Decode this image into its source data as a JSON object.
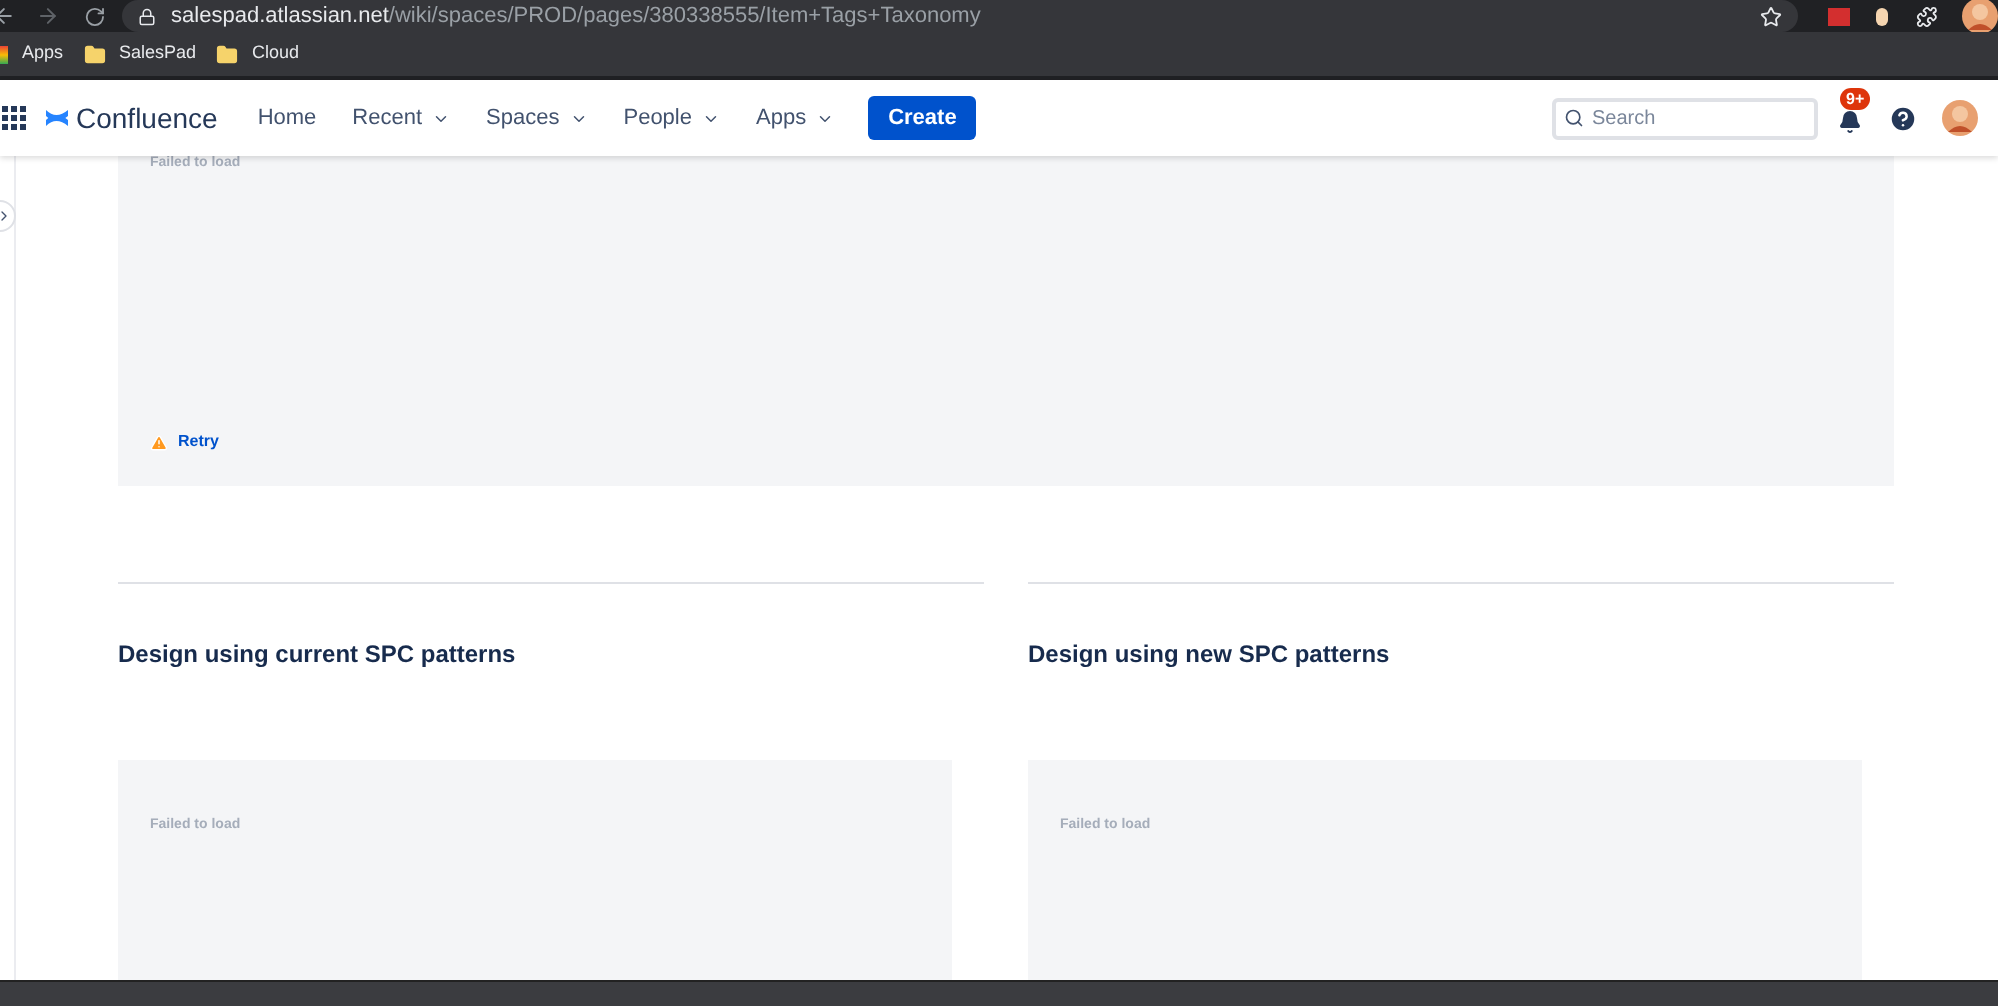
{
  "browser": {
    "url_host": "salespad.atlassian.net",
    "url_path": "/wiki/spaces/PROD/pages/380338555/Item+Tags+Taxonomy",
    "bookmarks": [
      "Apps",
      "SalesPad",
      "Cloud"
    ]
  },
  "nav": {
    "product": "Confluence",
    "items": [
      {
        "label": "Home",
        "dropdown": false
      },
      {
        "label": "Recent",
        "dropdown": true
      },
      {
        "label": "Spaces",
        "dropdown": true
      },
      {
        "label": "People",
        "dropdown": true
      },
      {
        "label": "Apps",
        "dropdown": true
      }
    ],
    "create": "Create",
    "search": {
      "placeholder": "Search"
    },
    "notification_badge": "9+"
  },
  "top_panel": {
    "message": "Failed to load",
    "retry": "Retry"
  },
  "columns": [
    {
      "heading": "Design using current SPC patterns",
      "message": "Failed to load"
    },
    {
      "heading": "Design using new SPC patterns",
      "message": "Failed to load"
    }
  ]
}
